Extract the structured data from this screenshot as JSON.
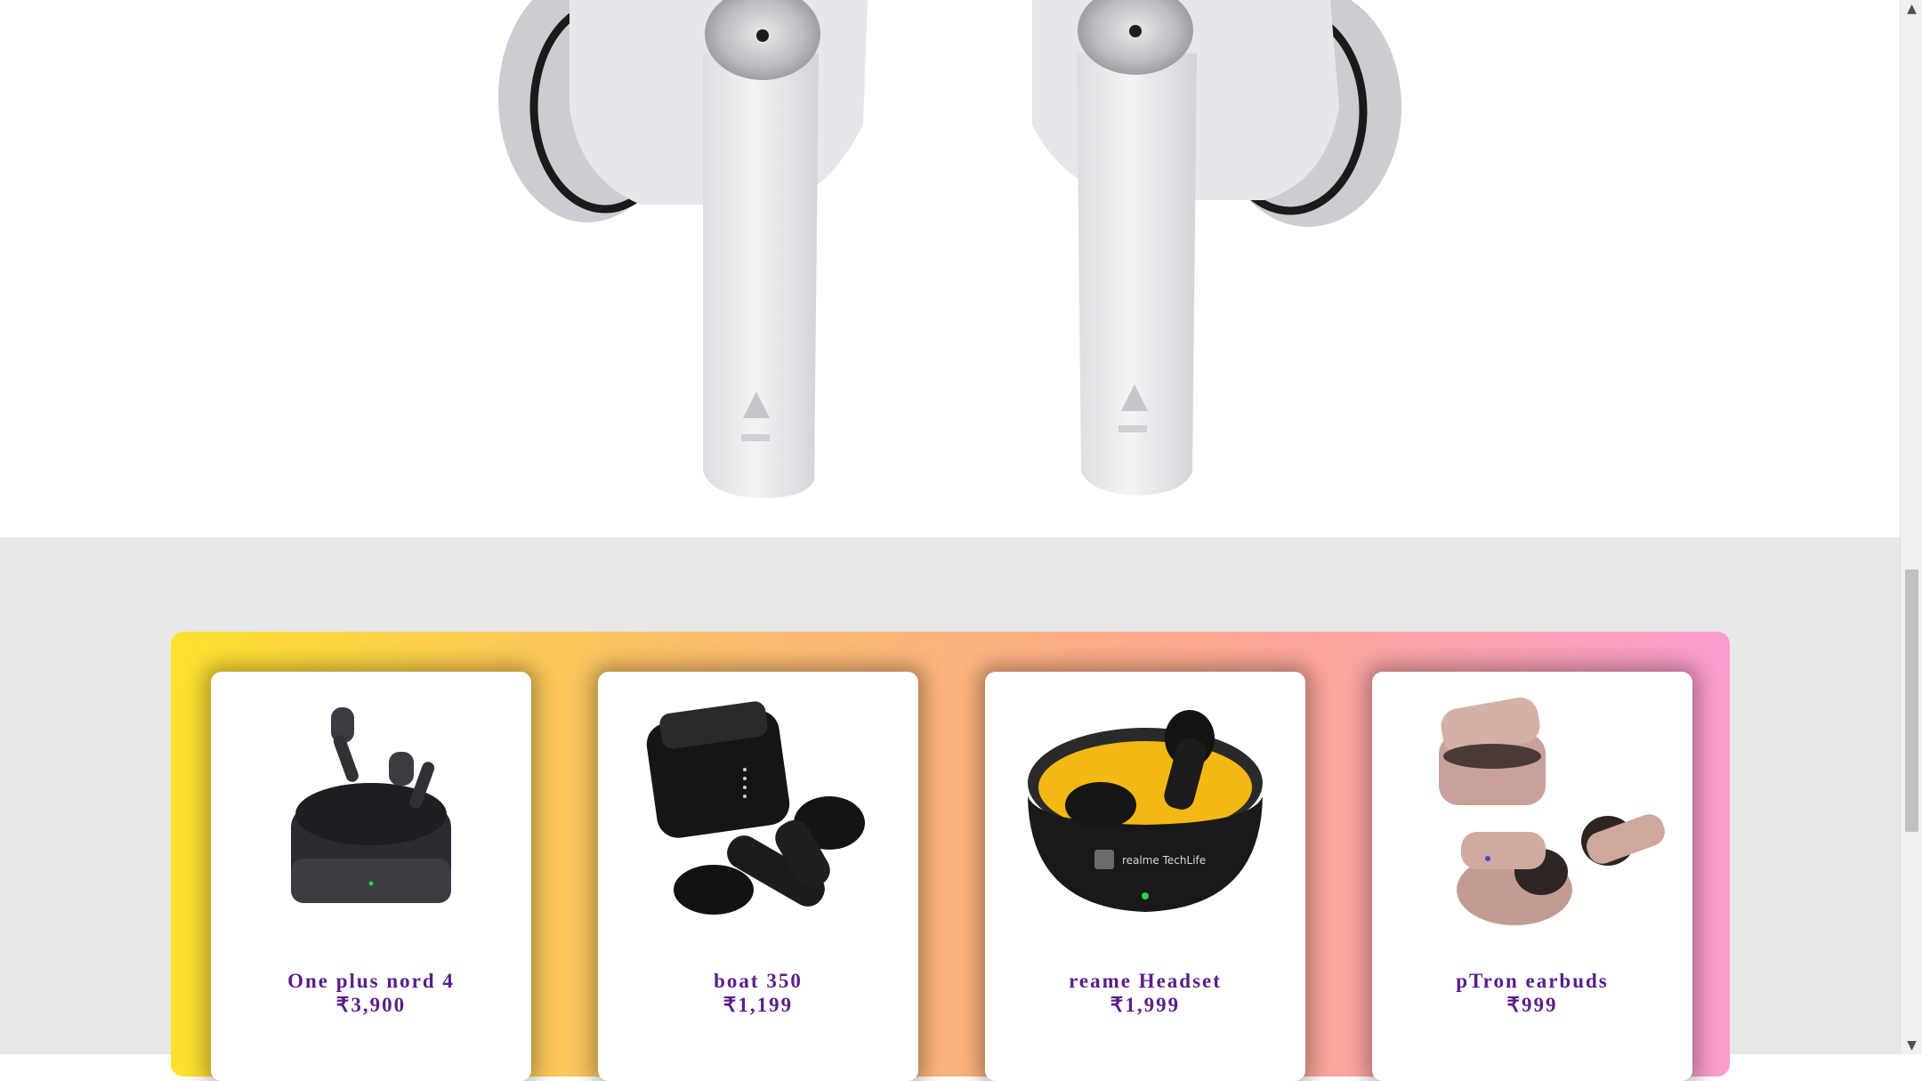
{
  "hero": {
    "image_label": "earbuds-hero"
  },
  "products": [
    {
      "name": "One plus nord 4",
      "price": "₹3,900",
      "image": "black-earbuds-open-case-icon"
    },
    {
      "name": "boat 350",
      "price": "₹1,199",
      "image": "black-earbuds-square-case-icon"
    },
    {
      "name": "reame Headset",
      "price": "₹1,999",
      "image": "black-yellow-earbuds-case-icon"
    },
    {
      "name": "pTron earbuds",
      "price": "₹999",
      "image": "rose-gold-earbuds-case-icon"
    }
  ],
  "colors": {
    "band_gradient": [
      "#fde02e",
      "#fbbf6a",
      "#fba88f",
      "#fa9ccd"
    ],
    "product_text": "#5a1d8a",
    "lower_bg": "#e8e8e8"
  }
}
